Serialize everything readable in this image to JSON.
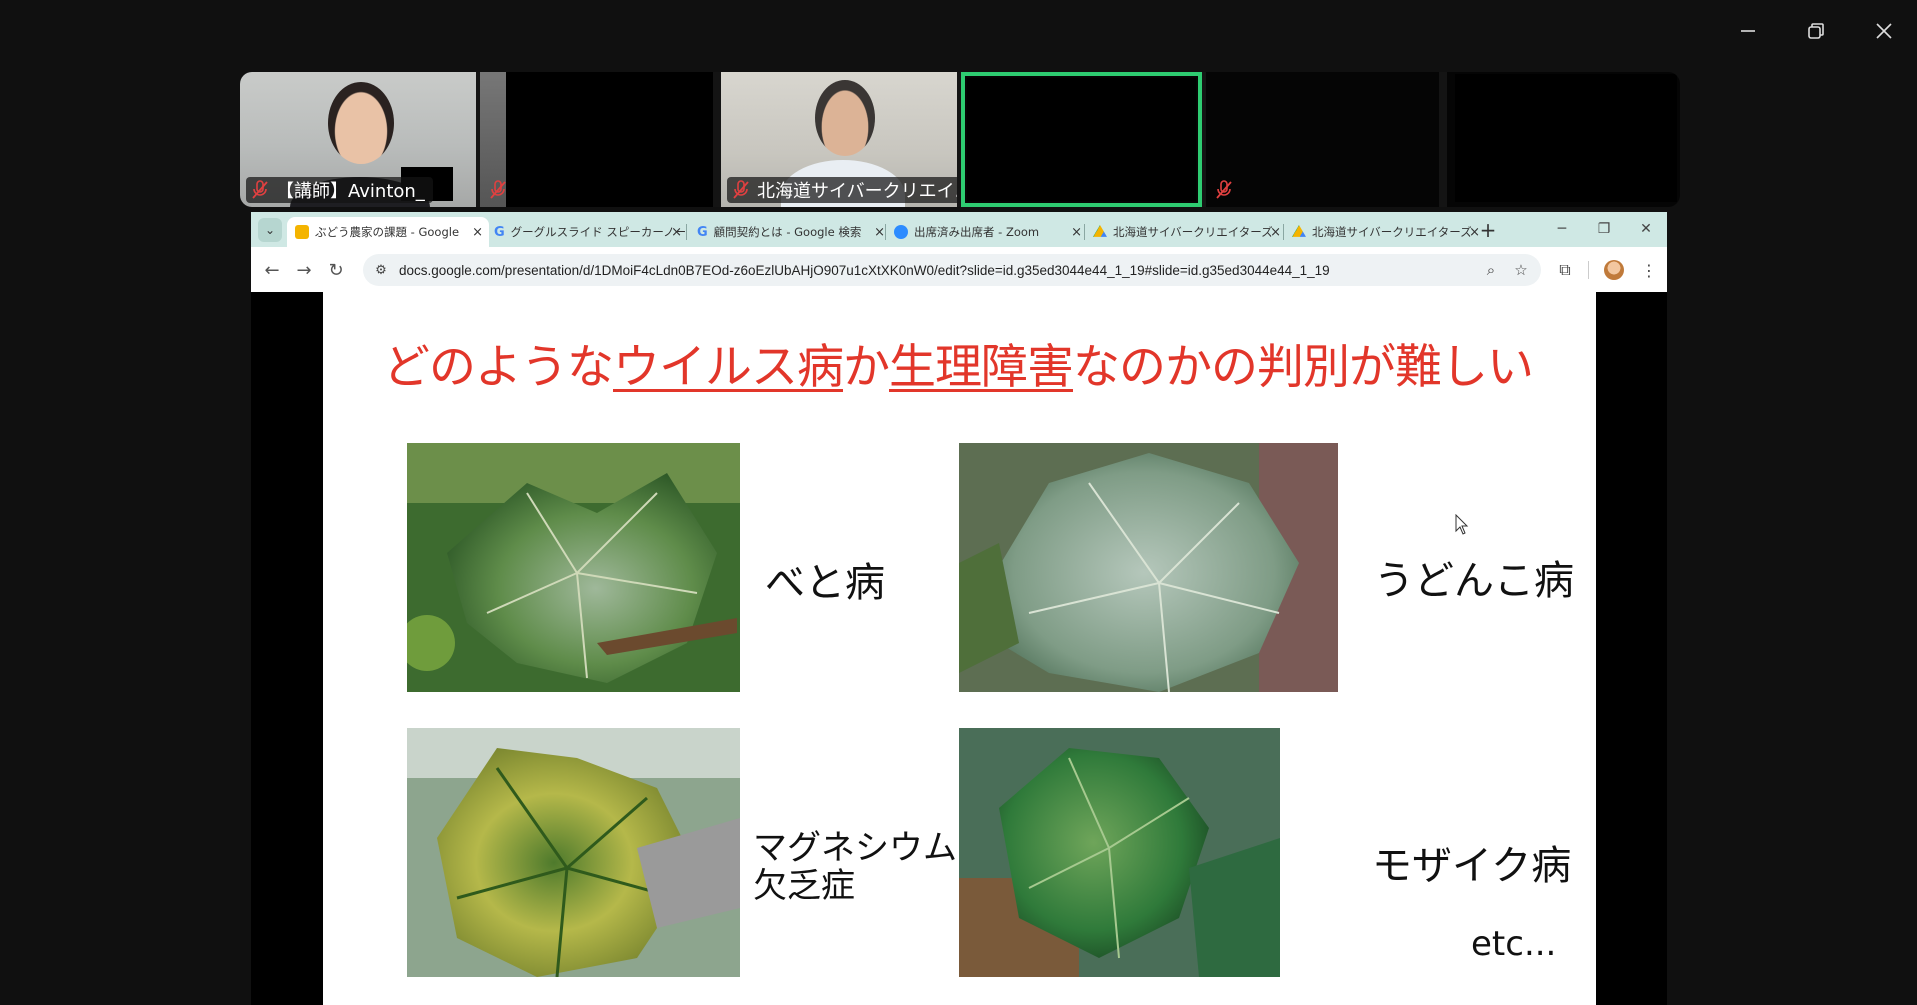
{
  "zoom": {
    "window_controls": [
      "minimize",
      "restore",
      "close"
    ],
    "participants": [
      {
        "name": "【講師】Avinton_",
        "muted": true,
        "video": true
      },
      {
        "name": "",
        "muted": true,
        "video": false
      },
      {
        "name": "北海道サイバークリエイ...",
        "muted": true,
        "video": true
      },
      {
        "name": "",
        "muted": false,
        "video": false,
        "active_speaker": true
      },
      {
        "name": "",
        "muted": true,
        "video": false
      },
      {
        "name": "",
        "muted": false,
        "video": false
      }
    ],
    "active_color": "#2ecc71"
  },
  "browser": {
    "tabs": [
      {
        "title": "ぶどう農家の課題 - Google",
        "icon": "slides-icon",
        "active": true
      },
      {
        "title": "グーグルスライド スピーカーノート",
        "icon": "google-icon"
      },
      {
        "title": "顧問契約とは - Google 検索",
        "icon": "google-icon"
      },
      {
        "title": "出席済み出席者 - Zoom",
        "icon": "zoom-icon"
      },
      {
        "title": "北海道サイバークリエイターズ",
        "icon": "drive-icon"
      },
      {
        "title": "北海道サイバークリエイターズ",
        "icon": "drive-icon"
      }
    ],
    "close_glyph": "×",
    "new_tab": "+",
    "url": "docs.google.com/presentation/d/1DMoiF4cLdn0B7EOd-z6oEzlUbAHjO907u1cXtXK0nW0/edit?slide=id.g35ed3044e44_1_19#slide=id.g35ed3044e44_1_19"
  },
  "slide": {
    "title_parts": [
      "どのような",
      "ウイルス病",
      "か",
      "生理障害",
      "なのかの判別が難しい"
    ],
    "title_color": "#e2362a",
    "labels": {
      "downy": "べと病",
      "powdery": "うどんこ病",
      "magnesium_line1": "マグネシウム",
      "magnesium_line2": "欠乏症",
      "mosaic": "モザイク病",
      "etc": "etc..."
    }
  }
}
